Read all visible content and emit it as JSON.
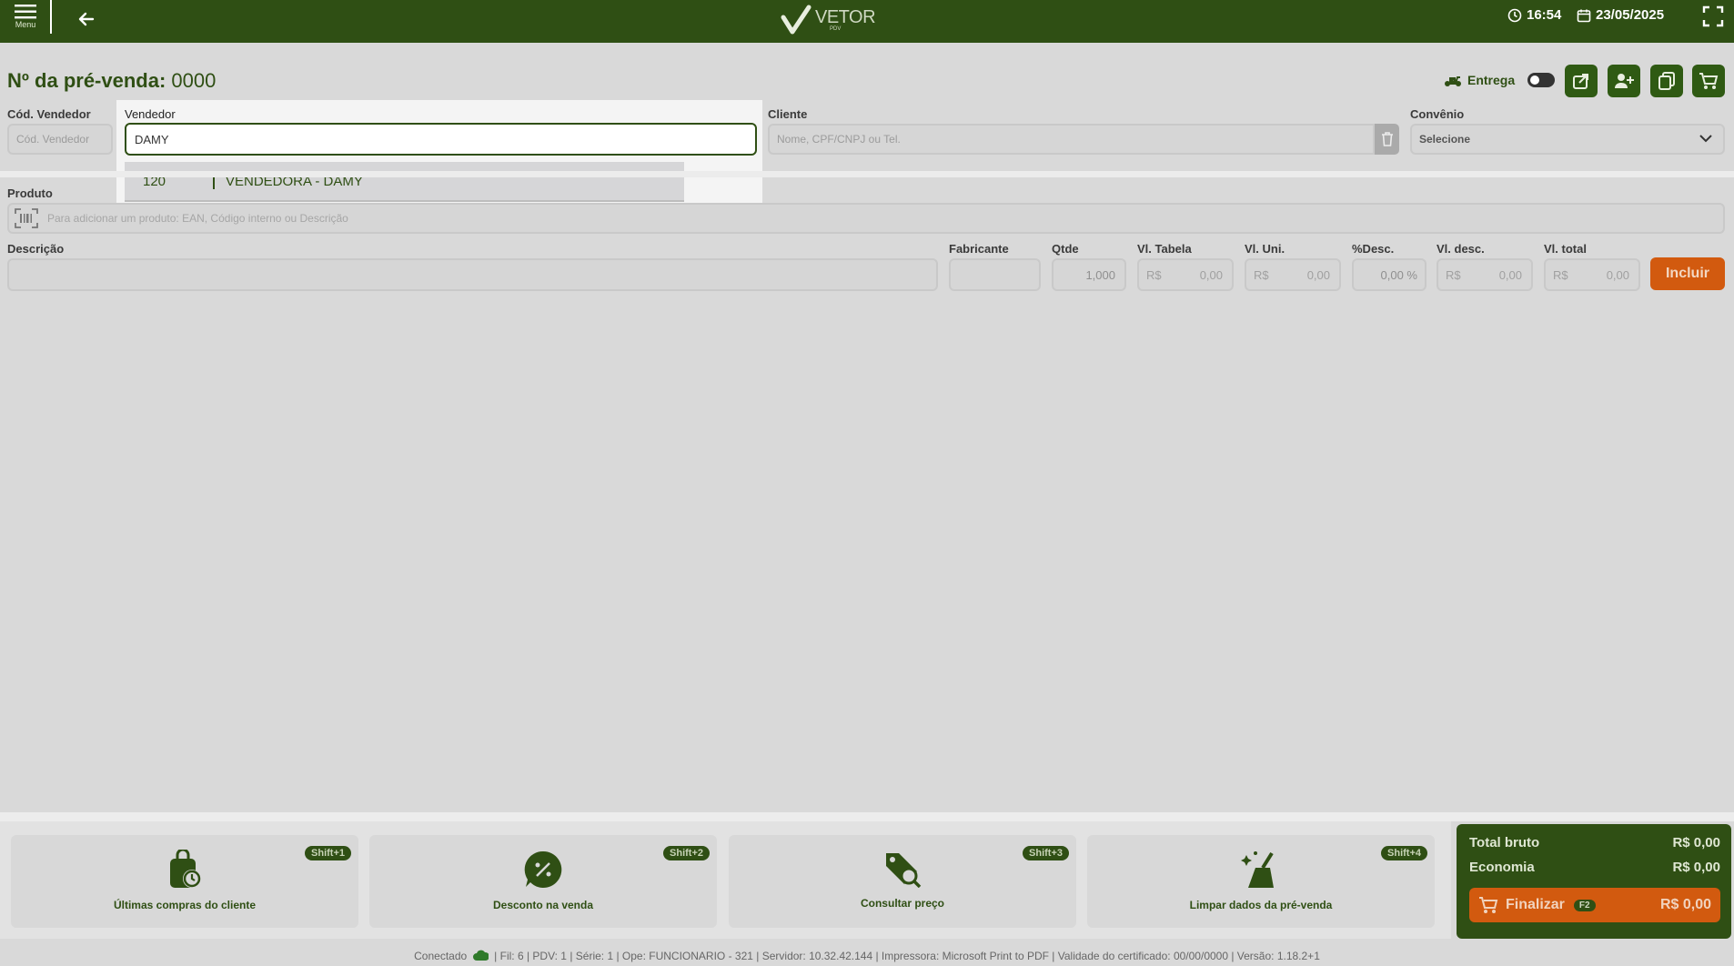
{
  "header": {
    "menu_label": "Menu",
    "logo_text": "VETOR",
    "logo_sub": "PDV",
    "time": "16:54",
    "date": "23/05/2025"
  },
  "page": {
    "title_label": "Nº da pré-venda:",
    "title_number": "0000",
    "entrega_label": "Entrega"
  },
  "form": {
    "cod_vendedor_label": "Cód. Vendedor",
    "cod_vendedor_placeholder": "Cód. Vendedor",
    "vendedor_label": "Vendedor",
    "vendedor_value": "DAMY",
    "vendedor_options": [
      {
        "code": "120",
        "name": "VENDEDORA - DAMY"
      }
    ],
    "cliente_label": "Cliente",
    "cliente_placeholder": "Nome, CPF/CNPJ ou Tel.",
    "convenio_label": "Convênio",
    "convenio_value": "Selecione",
    "produto_label": "Produto",
    "produto_placeholder": "Para adicionar um produto: EAN, Código interno ou Descrição"
  },
  "item_row": {
    "descricao_label": "Descrição",
    "fabricante_label": "Fabricante",
    "qtde_label": "Qtde",
    "qtde_value": "1,000",
    "vl_tabela_label": "Vl. Tabela",
    "vl_uni_label": "Vl. Uni.",
    "pct_desc_label": "%Desc.",
    "pct_desc_value": "0,00 %",
    "vl_desc_label": "Vl. desc.",
    "vl_total_label": "Vl. total",
    "currency": "R$",
    "zero_value": "0,00",
    "incluir_label": "Incluir"
  },
  "actions": [
    {
      "label": "Últimas compras do cliente",
      "shortcut": "Shift+1",
      "icon": "shopping-bag-clock-icon"
    },
    {
      "label": "Desconto na venda",
      "shortcut": "Shift+2",
      "icon": "discount-icon"
    },
    {
      "label": "Consultar preço",
      "shortcut": "Shift+3",
      "icon": "price-tag-search-icon"
    },
    {
      "label": "Limpar dados da pré-venda",
      "shortcut": "Shift+4",
      "icon": "broom-icon"
    }
  ],
  "totals": {
    "bruto_label": "Total bruto",
    "bruto_value": "R$ 0,00",
    "economia_label": "Economia",
    "economia_value": "R$ 0,00",
    "finalizar_label": "Finalizar",
    "finalizar_shortcut": "F2",
    "finalizar_value": "R$ 0,00"
  },
  "status_bar": {
    "conectado": "Conectado",
    "info": "| Fil: 6 | PDV: 1 | Série: 1 | Ope: FUNCIONARIO - 321 | Servidor: 10.32.42.144 | Impressora: Microsoft Print to PDF | Validade do certificado: 00/00/0000 | Versão: 1.18.2+1"
  },
  "colors": {
    "primary": "#2f4f14",
    "accent": "#d25a0f"
  }
}
